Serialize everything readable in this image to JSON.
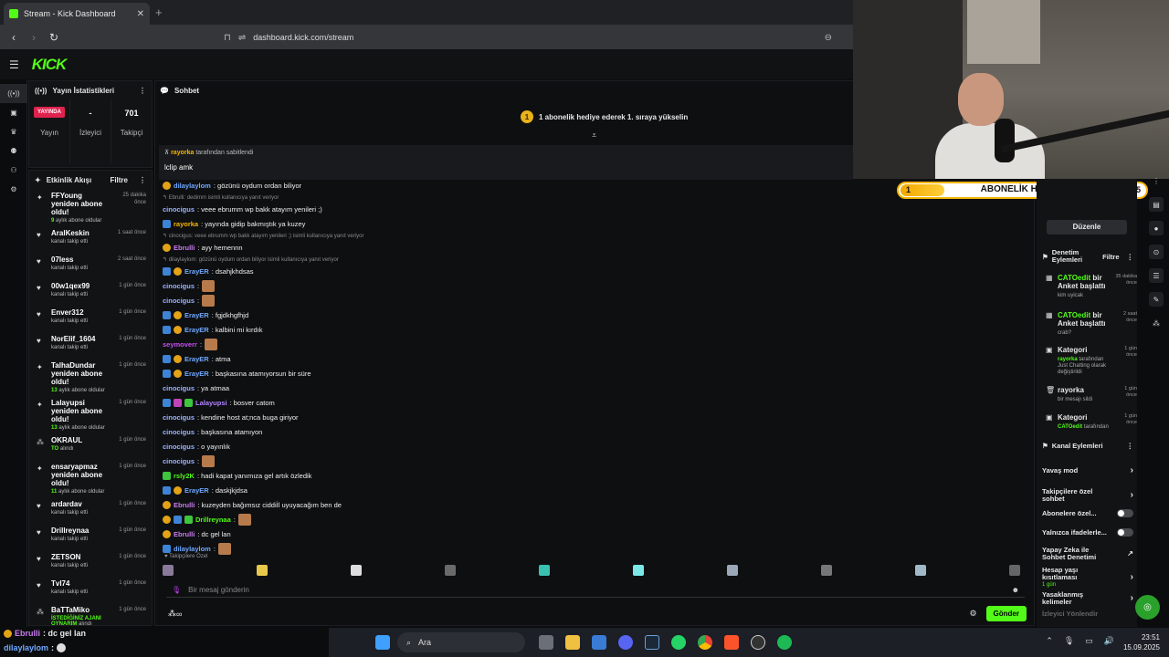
{
  "browser": {
    "tab_title": "Stream - Kick Dashboard",
    "tab_close": "✕",
    "new_tab": "+",
    "url": "dashboard.kick.com/stream"
  },
  "kick": {
    "logo": "KICK"
  },
  "stats": {
    "title": "Yayın İstatistikleri",
    "live_badge": "YAYINDA",
    "live_label": "Yayın",
    "viewers_value": "-",
    "viewers_label": "İzleyici",
    "followers_value": "701",
    "followers_label": "Takipçi"
  },
  "feed": {
    "title": "Etkinlik Akışı",
    "filter": "Filtre",
    "items": [
      {
        "name": "FFYoung yeniden abone oldu!",
        "sub_num": "9",
        "sub": " aylık abone oldular",
        "time": "25 dakika önce",
        "icon": "✦"
      },
      {
        "name": "AralKeskin",
        "sub_num": "",
        "sub": "kanalı takip etti",
        "time": "1 saat önce",
        "icon": "♥"
      },
      {
        "name": "07less",
        "sub_num": "",
        "sub": "kanalı takip etti",
        "time": "2 saat önce",
        "icon": "♥"
      },
      {
        "name": "00w1qex99",
        "sub_num": "",
        "sub": "kanalı takip etti",
        "time": "1 gün önce",
        "icon": "♥"
      },
      {
        "name": "Enver312",
        "sub_num": "",
        "sub": "kanalı takip etti",
        "time": "1 gün önce",
        "icon": "♥"
      },
      {
        "name": "NorElif_1604",
        "sub_num": "",
        "sub": "kanalı takip etti",
        "time": "1 gün önce",
        "icon": "♥"
      },
      {
        "name": "TalhaDundar yeniden abone oldu!",
        "sub_num": "13",
        "sub": " aylık abone oldular",
        "time": "1 gün önce",
        "icon": "✦"
      },
      {
        "name": "Lalayupsi yeniden abone oldu!",
        "sub_num": "13",
        "sub": " aylık abone oldular",
        "time": "1 gün önce",
        "icon": "✦"
      },
      {
        "name": "OKRAUL",
        "sub_num": "TO",
        "sub": " alındı",
        "time": "1 gün önce",
        "icon": "⁂"
      },
      {
        "name": "ensaryapmaz yeniden abone oldu!",
        "sub_num": "11",
        "sub": " aylık abone oldular",
        "time": "1 gün önce",
        "icon": "✦"
      },
      {
        "name": "ardardav",
        "sub_num": "",
        "sub": "kanalı takip etti",
        "time": "1 gün önce",
        "icon": "♥"
      },
      {
        "name": "Drillreynaa",
        "sub_num": "",
        "sub": "kanalı takip etti",
        "time": "1 gün önce",
        "icon": "♥"
      },
      {
        "name": "ZETSON",
        "sub_num": "",
        "sub": "kanalı takip etti",
        "time": "1 gün önce",
        "icon": "♥"
      },
      {
        "name": "Tvl74",
        "sub_num": "",
        "sub": "kanalı takip etti",
        "time": "1 gün önce",
        "icon": "♥"
      },
      {
        "name": "BaTTaMiko",
        "sub_num": "İSTEDİĞİNİZ AJANI OYNARIM",
        "sub": " alındı",
        "time": "1 gün önce",
        "icon": "⁂"
      }
    ]
  },
  "chat": {
    "title": "Sohbet",
    "goal_text": "1 abonelik hediye ederek 1. sıraya yükselin",
    "goal_coin": "1",
    "pinned_by": "rayorka",
    "pinned_suffix": " tarafından sabitlendi",
    "pinned_msg": "lclip amk",
    "messages": [
      {
        "type": "msg",
        "badges": [
          "gold"
        ],
        "user": "dilaylaylom",
        "color": "#6fa8ff",
        "text": ": gözünü oydum ordan biliyor"
      },
      {
        "type": "reply",
        "text": "↰ Ebrulli: dedimm isimli kullanıcıya yanıt veriyor"
      },
      {
        "type": "msg",
        "badges": [],
        "user": "cinocigus",
        "color": "#9bb3ff",
        "text": ": veee ebrumm wp bakk atayım yenileri ;)"
      },
      {
        "type": "msg",
        "badges": [
          "blue"
        ],
        "user": "rayorka",
        "color": "#f7b500",
        "text": ": yayında gidip bakmıştık ya kuzey"
      },
      {
        "type": "reply",
        "text": "↰ cinocigus: veee ebrumm wp bakk atayım yenileri ;) isimli kullanıcıya yanıt veriyor"
      },
      {
        "type": "msg",
        "badges": [
          "gold"
        ],
        "user": "Ebrulli",
        "color": "#c97cf0",
        "text": ": ayy hemennn"
      },
      {
        "type": "reply",
        "text": "↰ dilaylaylom: gözünü oydum ordan biliyor isimli kullanıcıya yanıt veriyor"
      },
      {
        "type": "msg",
        "badges": [
          "blue",
          "gold"
        ],
        "user": "ErayER",
        "color": "#6fa8ff",
        "text": ": dsahjkhdsas"
      },
      {
        "type": "msg",
        "badges": [],
        "user": "cinocigus",
        "color": "#9bb3ff",
        "text": ":",
        "emote": true
      },
      {
        "type": "msg",
        "badges": [],
        "user": "cinocigus",
        "color": "#9bb3ff",
        "text": ":",
        "emote": true
      },
      {
        "type": "msg",
        "badges": [
          "blue",
          "gold"
        ],
        "user": "ErayER",
        "color": "#6fa8ff",
        "text": ": fgjdkhgfhjd"
      },
      {
        "type": "msg",
        "badges": [
          "blue",
          "gold"
        ],
        "user": "ErayER",
        "color": "#6fa8ff",
        "text": ": kalbini mi kırdık"
      },
      {
        "type": "msg",
        "badges": [],
        "user": "seymoverr",
        "color": "#c44ef0",
        "text": ":",
        "emote": true
      },
      {
        "type": "msg",
        "badges": [
          "blue",
          "gold"
        ],
        "user": "ErayER",
        "color": "#6fa8ff",
        "text": ": atma"
      },
      {
        "type": "msg",
        "badges": [
          "blue",
          "gold"
        ],
        "user": "ErayER",
        "color": "#6fa8ff",
        "text": ": başkasına atamıyorsun bir süre"
      },
      {
        "type": "msg",
        "badges": [],
        "user": "cinocigus",
        "color": "#9bb3ff",
        "text": ": ya atmaa"
      },
      {
        "type": "msg",
        "badges": [
          "blue",
          "pink",
          "green"
        ],
        "user": "Lalayupsi",
        "color": "#b084ff",
        "text": ": bosver catom"
      },
      {
        "type": "msg",
        "badges": [],
        "user": "cinocigus",
        "color": "#9bb3ff",
        "text": ": kendine host at;nca buga giriyor"
      },
      {
        "type": "msg",
        "badges": [],
        "user": "cinocigus",
        "color": "#9bb3ff",
        "text": ": başkasına atamıyon"
      },
      {
        "type": "msg",
        "badges": [],
        "user": "cinocigus",
        "color": "#9bb3ff",
        "text": ": o yayınlık"
      },
      {
        "type": "msg",
        "badges": [],
        "user": "cinocigus",
        "color": "#9bb3ff",
        "text": ":",
        "emote": true
      },
      {
        "type": "msg",
        "badges": [
          "green"
        ],
        "user": "rsly2K",
        "color": "#53fc18",
        "text": ": hadi kapat yanımıza gel artık özledik"
      },
      {
        "type": "msg",
        "badges": [
          "blue",
          "gold"
        ],
        "user": "ErayER",
        "color": "#6fa8ff",
        "text": ": daskjkjdsa"
      },
      {
        "type": "msg",
        "badges": [
          "gold"
        ],
        "user": "Ebrulli",
        "color": "#c97cf0",
        "text": ": kuzeyden bağımsız ciddiİl uyuyacağım ben de"
      },
      {
        "type": "msg",
        "badges": [
          "gold",
          "blue",
          "green"
        ],
        "user": "Drillreynaa",
        "color": "#53fc18",
        "text": ":",
        "emote": true
      },
      {
        "type": "msg",
        "badges": [
          "gold"
        ],
        "user": "Ebrulli",
        "color": "#c97cf0",
        "text": ": dc gel lan"
      },
      {
        "type": "msg",
        "badges": [
          "blue"
        ],
        "user": "dilaylaylom",
        "color": "#6fa8ff",
        "text": ":",
        "emote": true
      }
    ],
    "followers_only": "Takipçilere Özel",
    "input_placeholder": "Bir mesaj gönderin",
    "send": "Gönder",
    "infinity": "∞"
  },
  "subgoal": {
    "label": "ABONELİK HEDEFİ",
    "current": "1",
    "target": "5",
    "progress": 0.2
  },
  "mod": {
    "edit": "Düzenle",
    "actions_title": "Denetim Eylemleri",
    "filter": "Filtre",
    "items": [
      {
        "icon": "▦",
        "user": "CATOedit",
        "text": " bir Anket başlattı",
        "sub": "kim uyicak",
        "subb": "",
        "time": "35 dakika önce"
      },
      {
        "icon": "▦",
        "user": "CATOedit",
        "text": " bir Anket başlattı",
        "sub": "crab?",
        "subb": "",
        "time": "2 saat önce"
      },
      {
        "icon": "▣",
        "user": "",
        "text": "Kategori",
        "sub": " tarafından Just Chatting olarak değiştirildi",
        "subb": "rayorka",
        "time": "1 gün önce"
      },
      {
        "icon": "🗑",
        "user": "",
        "text": "rayorka",
        "sub": "bir mesajı sildi",
        "subb": "",
        "time": "1 gün önce"
      },
      {
        "icon": "▣",
        "user": "",
        "text": "Kategori",
        "sub": " tarafından",
        "subb": "CATOedit",
        "time": "1 gün önce"
      }
    ],
    "channel_title": "Kanal Eylemleri",
    "options": [
      {
        "label": "Yavaş mod",
        "kind": "arrow"
      },
      {
        "label": "Takipçilere özel sohbet",
        "kind": "arrow"
      },
      {
        "label": "Abonelere özel...",
        "kind": "toggle"
      },
      {
        "label": "Yalnızca ifadelerle...",
        "kind": "toggle"
      },
      {
        "label": "Yapay Zeka ile Sohbet Denetimi",
        "kind": "ext"
      },
      {
        "label": "Hesap yaşı kısıtlaması",
        "sub": "1 gün",
        "kind": "arrow"
      },
      {
        "label": "Yasaklanmış kelimeler",
        "kind": "arrow"
      },
      {
        "label": "İzleyici Yönlendir",
        "kind": "none"
      }
    ]
  },
  "overlay": {
    "line1_user": "Ebrulli",
    "line1_text": ": dc gel lan",
    "line2_user": "dilaylaylom",
    "line2_text": ":"
  },
  "taskbar": {
    "search": "Ara",
    "time": "23:51",
    "date": "15.09.2025"
  }
}
